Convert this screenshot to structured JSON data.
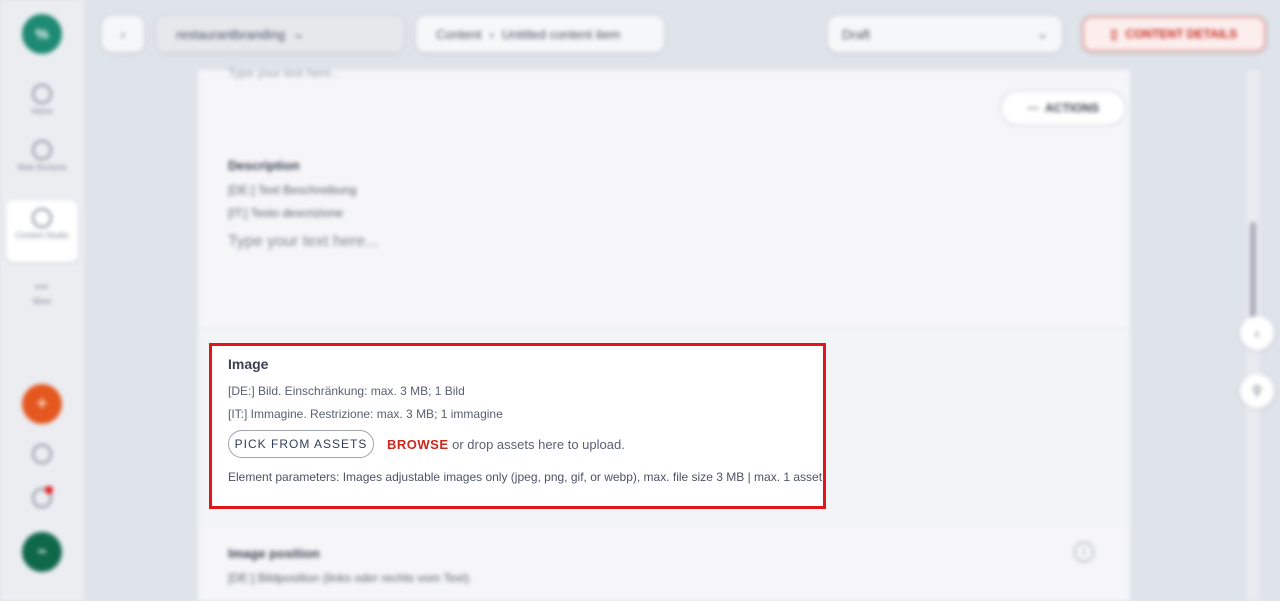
{
  "app": {
    "logo_text": "%",
    "colors": {
      "accent_red": "#c8281e",
      "focus_border": "#e3141b",
      "brand_green": "#1e8a74",
      "orange": "#e4571e",
      "dark_green": "#10684a"
    }
  },
  "sidebar": {
    "items": [
      {
        "label": "Home",
        "icon": "globe-icon"
      },
      {
        "label": "Web Sections",
        "icon": "globe-icon"
      },
      {
        "label": "Content Studio",
        "icon": "globe-icon",
        "active": true
      },
      {
        "label": "More",
        "icon": "grid-icon"
      }
    ],
    "bottom": {
      "add_icon": "plus-icon",
      "settings_icon": "gear-icon",
      "notifications_icon": "bell-icon",
      "avatar_initials": "••"
    }
  },
  "header": {
    "back_icon": "chevron-left-icon",
    "workspace": "restaurantbranding",
    "breadcrumb_root": "Content",
    "breadcrumb_current": "Untitled content item",
    "status_select": "Draft",
    "action_button": "Content Details"
  },
  "editor": {
    "top_hint": "Type your text here...",
    "actions_button": "Actions",
    "description": {
      "label": "Description",
      "de": "[DE:] Text Beschreibung",
      "it": "[IT:] Testo descrizione",
      "placeholder": "Type your text here..."
    },
    "image": {
      "title": "Image",
      "de_hint": "[DE:] Bild. Einschränkung: max. 3 MB; 1 Bild",
      "it_hint": "[IT:] Immagine. Restrizione: max. 3 MB; 1 immagine",
      "pick_button": "PICK FROM ASSETS",
      "browse_link": "BROWSE",
      "browse_suffix": " or drop assets here to upload.",
      "parameters": "Element parameters: Images adjustable images only (jpeg, png, gif, or webp), max. file size 3 MB | max. 1 asset"
    },
    "image_position": {
      "label": "Image position",
      "de": "[DE:] Bildposition (links oder rechts vom Text)"
    }
  }
}
